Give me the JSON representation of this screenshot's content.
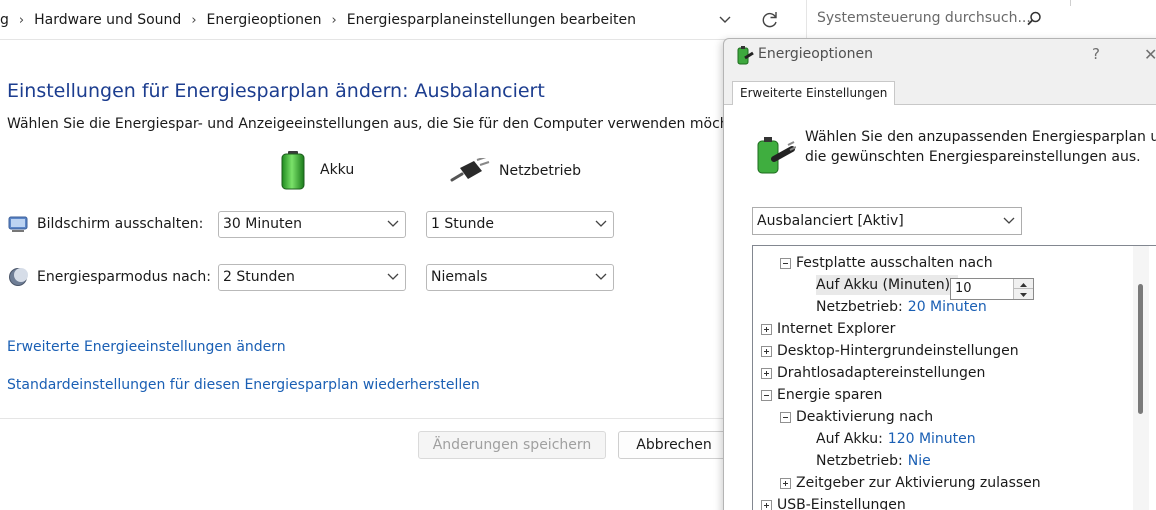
{
  "address_bar": {
    "breadcrumbs": [
      "g",
      "Hardware und Sound",
      "Energieoptionen",
      "Energiesparplaneinstellungen bearbeiten"
    ],
    "search_placeholder": "Systemsteuerung durchsuch..."
  },
  "main": {
    "title": "Einstellungen für Energiesparplan ändern: Ausbalanciert",
    "subtitle": "Wählen Sie die Energiespar- und Anzeigeeinstellungen aus, die Sie für den Computer verwenden möchten.",
    "col_battery": "Akku",
    "col_plugged": "Netzbetrieb",
    "rows": [
      {
        "label": "Bildschirm ausschalten:",
        "battery": "30 Minuten",
        "plugged": "1 Stunde"
      },
      {
        "label": "Energiesparmodus nach:",
        "battery": "2 Stunden",
        "plugged": "Niemals"
      }
    ],
    "link_advanced": "Erweiterte Energieeinstellungen ändern",
    "link_restore": "Standardeinstellungen für diesen Energiesparplan wiederherstellen",
    "btn_save": "Änderungen speichern",
    "btn_cancel": "Abbrechen"
  },
  "dialog": {
    "title": "Energieoptionen",
    "help": "?",
    "close": "✕",
    "tab": "Erweiterte Einstellungen",
    "desc_line1": "Wählen Sie den anzupassenden Energiesparplan und",
    "desc_line2": "die gewünschten Energiespareinstellungen aus.",
    "plan": "Ausbalanciert [Aktiv]",
    "tree": {
      "festplatte": "Festplatte ausschalten nach",
      "auf_akku_min": "Auf Akku (Minuten):",
      "auf_akku_min_value": "10",
      "netzbetrieb_label": "Netzbetrieb:",
      "netzbetrieb_value": "20 Minuten",
      "ie": "Internet Explorer",
      "desktop": "Desktop-Hintergrundeinstellungen",
      "drahtlos": "Drahtlosadaptereinstellungen",
      "energie": "Energie sparen",
      "deaktivierung": "Deaktivierung nach",
      "auf_akku": "Auf Akku:",
      "auf_akku_value": "120 Minuten",
      "netz2_label": "Netzbetrieb:",
      "netz2_value": "Nie",
      "zeitgeber": "Zeitgeber zur Aktivierung zulassen",
      "usb": "USB-Einstellungen"
    }
  },
  "colors": {
    "title_blue": "#1c3d8f",
    "link_blue": "#1a5fb4"
  }
}
